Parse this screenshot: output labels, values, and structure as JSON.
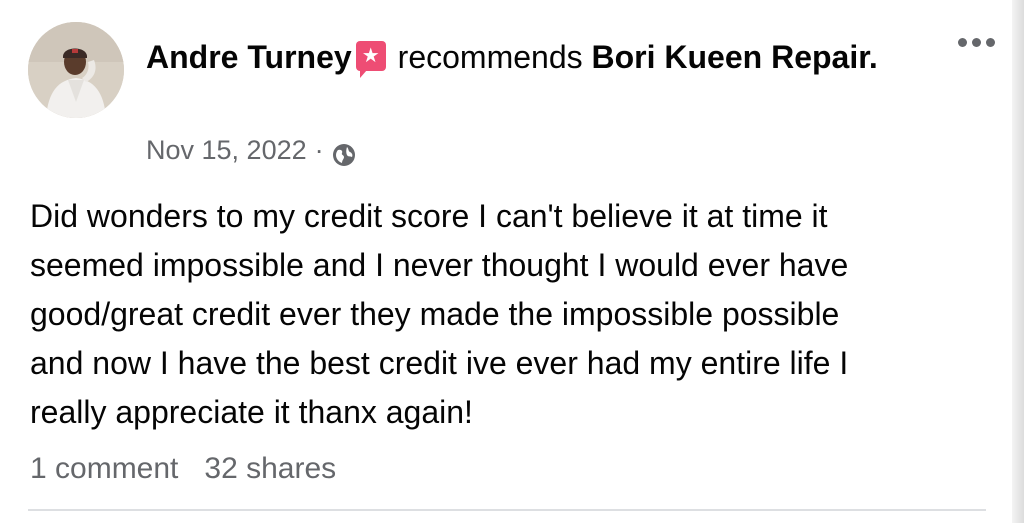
{
  "post": {
    "author": "Andre Turney",
    "action": "recommends",
    "page_name": "Bori Kueen Repair.",
    "date": "Nov 15, 2022",
    "separator": "·",
    "privacy_icon": "globe-icon",
    "badge_icon": "recommendation-star-icon",
    "badge_glyph": "★",
    "badge_color": "#ee4d74",
    "text": "Did wonders to my credit score I can't believe it at time it\nseemed impossible and I never thought I would ever have\ngood/great credit ever they made the impossible possible\nand now I have the best credit ive ever had my entire life I\nreally appreciate it thanx again!"
  },
  "stats": {
    "comments": "1 comment",
    "shares": "32 shares"
  },
  "menu_icon": "more-options-icon"
}
